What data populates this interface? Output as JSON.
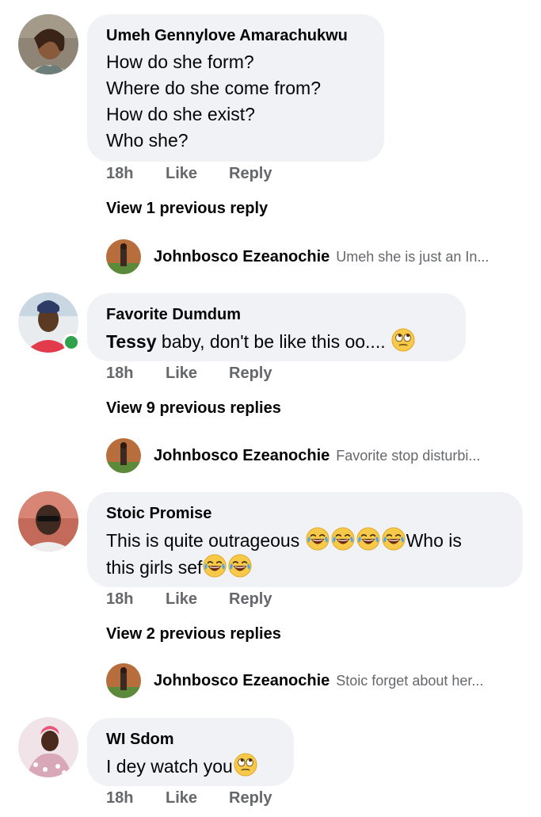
{
  "comments": [
    {
      "author": "Umeh Gennylove Amarachukwu",
      "lines": [
        "How do she form?",
        "Where do she come from?",
        "How do she exist?",
        "Who she?"
      ],
      "time": "18h",
      "like": "Like",
      "reply": "Reply",
      "view_previous": "View 1 previous reply",
      "latest_reply": {
        "author": "Johnbosco Ezeanochie",
        "snippet": "Umeh she is just an In..."
      }
    },
    {
      "author": "Favorite Dumdum",
      "mention": "Tessy",
      "text": " baby, don't be like this oo....",
      "emoji": "rolling-eyes",
      "online": true,
      "time": "18h",
      "like": "Like",
      "reply": "Reply",
      "view_previous": "View 9 previous replies",
      "latest_reply": {
        "author": "Johnbosco Ezeanochie",
        "snippet": "Favorite stop disturbi..."
      }
    },
    {
      "author": "Stoic Promise",
      "text_a": "This is quite outrageous ",
      "text_b": "Who is",
      "text_c": "this girls sef",
      "emoji": "tears-of-joy",
      "time": "18h",
      "like": "Like",
      "reply": "Reply",
      "view_previous": "View 2 previous replies",
      "latest_reply": {
        "author": "Johnbosco Ezeanochie",
        "snippet": "Stoic forget about her..."
      }
    },
    {
      "author": "WI Sdom",
      "text": "I dey watch you",
      "emoji": "rolling-eyes",
      "time": "18h",
      "like": "Like",
      "reply": "Reply"
    }
  ],
  "colors": {
    "bubble": "#f0f2f5",
    "secondary_text": "#65676b",
    "online": "#31a24c"
  }
}
